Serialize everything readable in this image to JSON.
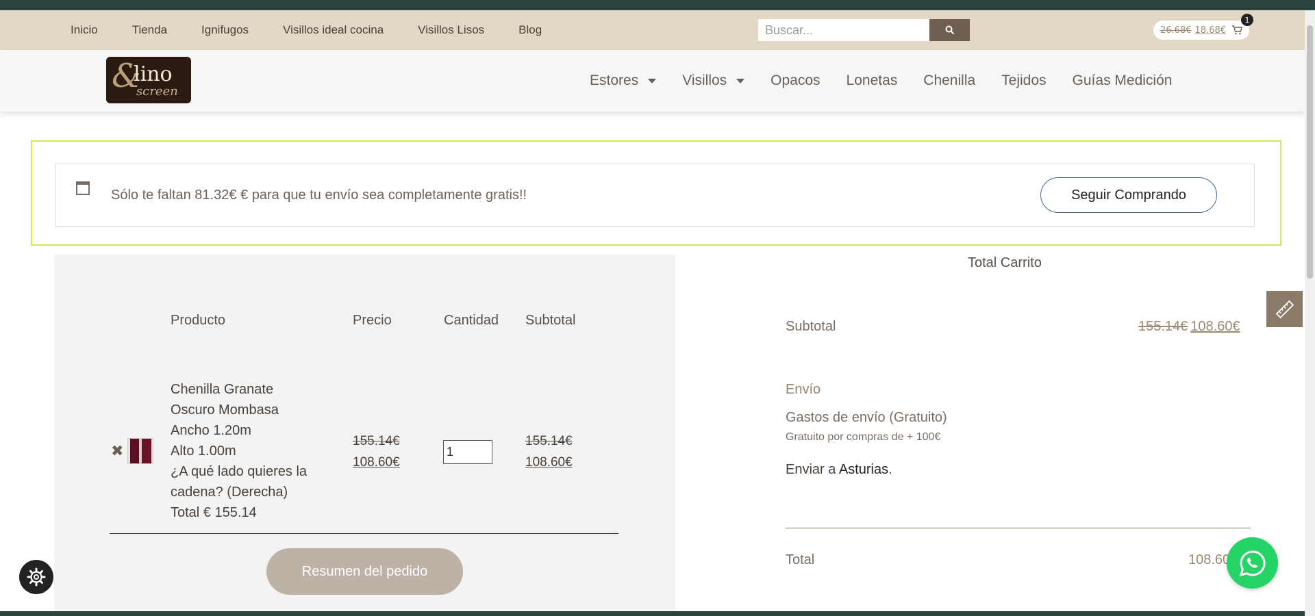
{
  "topbar": {
    "nav": [
      "Inicio",
      "Tienda",
      "Ignifugos",
      "Visillos ideal cocina",
      "Visillos Lisos",
      "Blog"
    ],
    "search_placeholder": "Buscar...",
    "minicart": {
      "old_price": "26.68€",
      "new_price": "18.68€",
      "count": "1"
    }
  },
  "header": {
    "logo": {
      "amp": "&",
      "line1": "lino",
      "line2": "screen"
    },
    "nav": [
      "Estores",
      "Visillos",
      "Opacos",
      "Lonetas",
      "Chenilla",
      "Tejidos",
      "Guías Medición"
    ]
  },
  "notice": {
    "text": "Sólo te faltan 81.32€ € para que tu envío sea completamente gratis!!",
    "button": "Seguir Comprando"
  },
  "cart": {
    "headers": {
      "product": "Producto",
      "price": "Precio",
      "qty": "Cantidad",
      "subtotal": "Subtotal"
    },
    "item": {
      "lines": [
        "Chenilla Granate",
        "Oscuro Mombasa",
        "Ancho 1.20m",
        "Alto 1.00m",
        "¿A qué lado quieres la",
        "cadena? (Derecha)",
        "Total € 155.14"
      ],
      "price_old": "155.14€",
      "price_new": "108.60€",
      "qty": "1",
      "subtotal_old": "155.14€",
      "subtotal_new": "108.60€",
      "remove_icon": "✖"
    },
    "summary_button": "Resumen del pedido"
  },
  "totals": {
    "title": "Total Carrito",
    "subtotal_label": "Subtotal",
    "subtotal_old": "155.14€",
    "subtotal_new": "108.60€",
    "envio_label": "Envío",
    "shipping_method": "Gastos de envío (Gratuito)",
    "shipping_note": "Gratuito por compras de + 100€",
    "ship_to_prefix": "Enviar a ",
    "ship_to_place": "Asturias",
    "ship_to_suffix": ".",
    "total_label": "Total",
    "total_value": "108.60"
  },
  "colors": {
    "topbar": "#e2d8c5",
    "accent": "#6e5f50",
    "notice_border": "#d4ec4a",
    "whatsapp": "#25d366"
  },
  "icons": [
    "search-icon",
    "cart-icon",
    "ruler-icon",
    "gear-icon",
    "whatsapp-icon",
    "calendar-icon",
    "remove-icon"
  ]
}
